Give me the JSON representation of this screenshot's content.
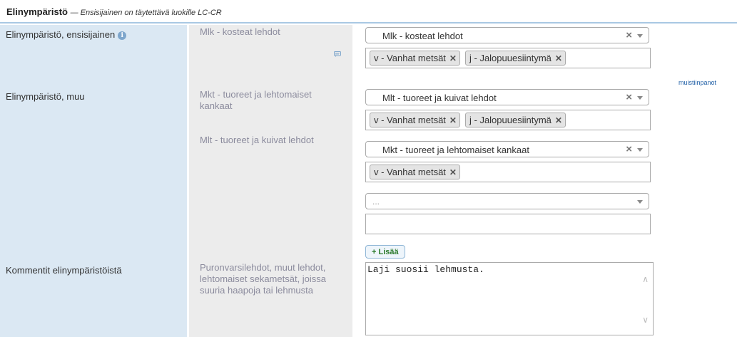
{
  "header": {
    "title": "Elinympäristö",
    "subtitle": "— Ensisijainen on täytettävä luokille LC-CR"
  },
  "rows": {
    "primary": {
      "label": "Elinympäristö, ensisijainen",
      "original": "Mlk - kosteat lehdot",
      "select_value": "Mlk - kosteat lehdot",
      "tags": [
        "v - Vanhat metsät",
        "j - Jalopuuesiintymä"
      ],
      "notes_link": "muistiinpanot"
    },
    "other": {
      "label": "Elinympäristö, muu",
      "original_1": "Mkt - tuoreet ja lehtomaiset kankaat",
      "original_2": "Mlt - tuoreet ja kuivat lehdot",
      "select_1_value": "Mlt - tuoreet ja kuivat lehdot",
      "tags_1": [
        "v - Vanhat metsät",
        "j - Jalopuuesiintymä"
      ],
      "select_2_value": "Mkt - tuoreet ja lehtomaiset kankaat",
      "tags_2": [
        "v - Vanhat metsät"
      ],
      "select_3_placeholder": "...",
      "add_label": "+ Lisää"
    },
    "comments": {
      "label": "Kommentit elinympäristöistä",
      "original": "Puronvarsilehdot, muut lehdot, lehtomaiset sekametsät, joissa suuria haapoja tai lehmusta",
      "value": "Laji suosii lehmusta."
    }
  },
  "icons": {
    "info": "info-icon",
    "note": "comment-icon",
    "clear": "clear-icon",
    "dropdown": "chevron-down-icon",
    "tag_remove": "remove-tag-icon"
  },
  "colors": {
    "label_bg": "#dbe8f3",
    "original_bg": "#ececec",
    "accent_line": "#a9c8e3",
    "link": "#1f5fa6",
    "add_text": "#2b7a2b"
  }
}
